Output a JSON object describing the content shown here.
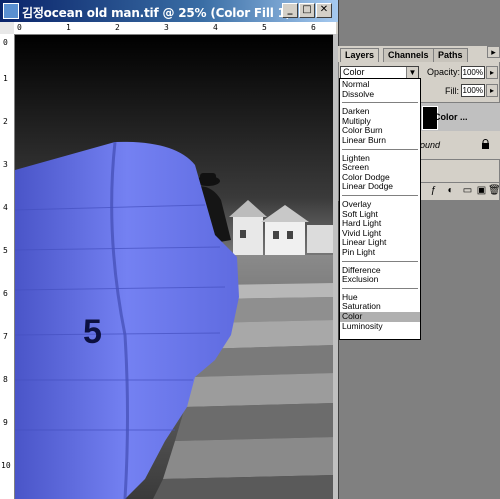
{
  "window": {
    "title": "김정ocean old man.tif @ 25% (Color Fill 1, ...",
    "minimize_label": "_",
    "maximize_label": "□",
    "close_label": "✕"
  },
  "rulers": {
    "top": [
      "0",
      "1",
      "2",
      "3",
      "4",
      "5",
      "6"
    ],
    "left": [
      "0",
      "1",
      "2",
      "3",
      "4",
      "5",
      "6",
      "7",
      "8",
      "9",
      "10"
    ]
  },
  "artwork": {
    "number_label": "5"
  },
  "layers_palette": {
    "tabs": [
      "Layers",
      "Channels",
      "Paths"
    ],
    "blend_mode": "Color",
    "opacity_label": "Opacity:",
    "opacity_value": "100%",
    "fill_label": "Fill:",
    "fill_value": "100%",
    "layers": [
      {
        "name": "Color ..."
      },
      {
        "name": "ound"
      }
    ]
  },
  "blend_modes": [
    [
      "Normal",
      "Dissolve"
    ],
    [
      "Darken",
      "Multiply",
      "Color Burn",
      "Linear Burn"
    ],
    [
      "Lighten",
      "Screen",
      "Color Dodge",
      "Linear Dodge"
    ],
    [
      "Overlay",
      "Soft Light",
      "Hard Light",
      "Vivid Light",
      "Linear Light",
      "Pin Light"
    ],
    [
      "Difference",
      "Exclusion"
    ],
    [
      "Hue",
      "Saturation",
      "Color",
      "Luminosity"
    ]
  ],
  "selected_blend_mode": "Color",
  "colors": {
    "titlebar": "#0a246a",
    "fill_overlay": "#6a78f0",
    "chrome": "#d4d0c8"
  }
}
